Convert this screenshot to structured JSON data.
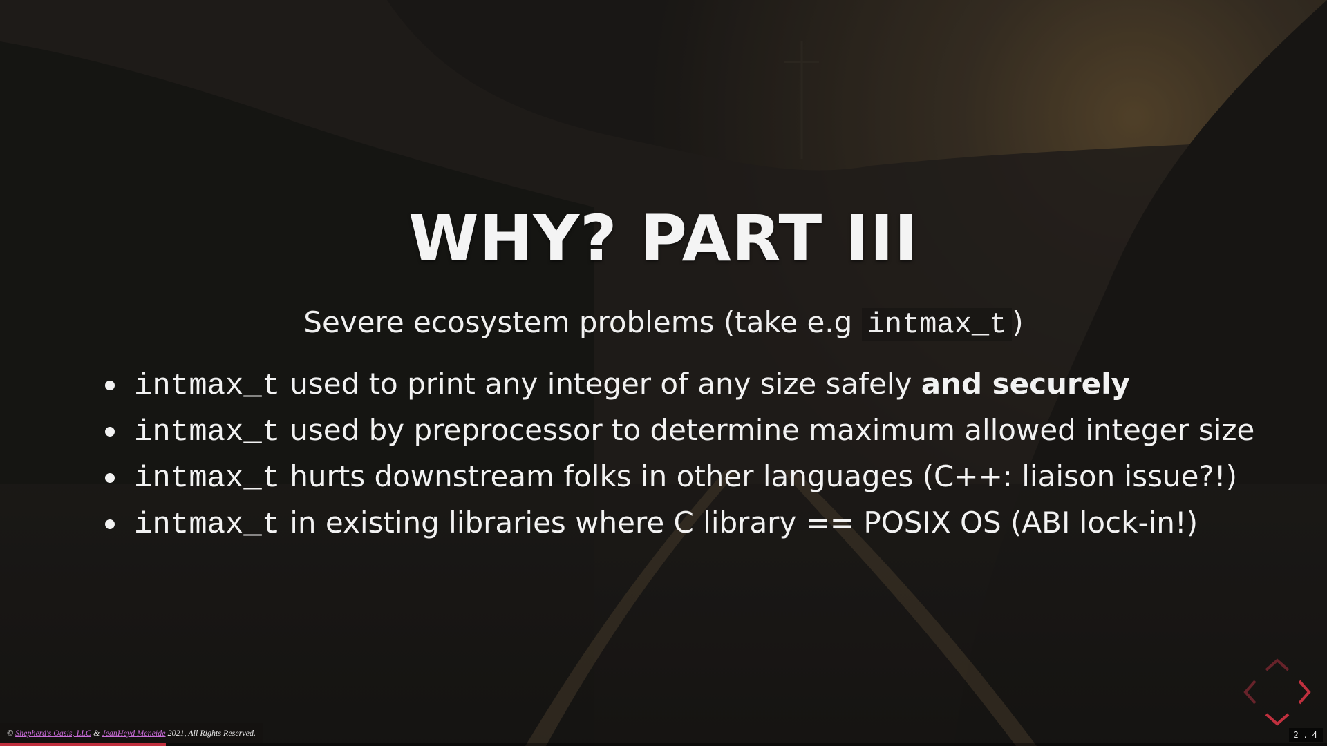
{
  "slide": {
    "title": "WHY? PART III",
    "subtitle": {
      "prefix": "Severe ecosystem problems (take e.g ",
      "code": "intmax_t",
      "suffix": ")"
    },
    "bullets": [
      {
        "code": "intmax_t",
        "text": "used to print any integer of any size safely ",
        "bold": "and securely"
      },
      {
        "code": "intmax_t",
        "text": "used by preprocessor to determine maximum allowed integer size",
        "bold": ""
      },
      {
        "code": "intmax_t",
        "text": "hurts downstream folks in other languages (C++: liaison issue?!)",
        "bold": ""
      },
      {
        "code": "intmax_t",
        "text": "in existing libraries where C library == POSIX OS (ABI lock-in!)",
        "bold": ""
      }
    ]
  },
  "footer": {
    "copyright_symbol": "©",
    "link1": "Shepherd's Oasis, LLC",
    "ampersand": "&",
    "link2": "JeanHeyd Meneide",
    "rest": "2021, All Rights Reserved."
  },
  "navigation": {
    "slide_number": "2 . 4",
    "progress": 0.125,
    "icons": [
      "chevron-left-icon",
      "chevron-right-icon",
      "chevron-up-icon",
      "chevron-down-icon"
    ]
  },
  "colors": {
    "accent": "#c0303e",
    "link": "#c86cd8",
    "text": "#f2f2f2"
  }
}
